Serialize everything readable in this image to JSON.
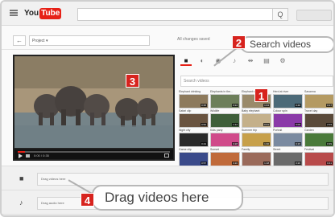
{
  "app": {
    "logo_you": "You",
    "logo_tube": "Tube",
    "search_button": "Q"
  },
  "project_bar": {
    "back": "←",
    "project_name": "Project ▾",
    "status": "All changes saved"
  },
  "player": {
    "time": "0:00 / 0:35",
    "progress": 0.05
  },
  "panel": {
    "tabs": [
      {
        "icon": "■",
        "name": "videos-tab"
      },
      {
        "icon": "◐",
        "name": "creative-commons-tab"
      },
      {
        "icon": "◉",
        "name": "photos-tab"
      },
      {
        "icon": "♪",
        "name": "music-tab"
      },
      {
        "icon": "⇹",
        "name": "transitions-tab"
      },
      {
        "icon": "▤",
        "name": "titles-tab"
      },
      {
        "icon": "⚙",
        "name": "settings-tab"
      }
    ],
    "search_placeholder": "Search videos",
    "thumbnails": [
      {
        "title": "Elephant drinking",
        "duration": "0:35",
        "color": "#8d7a5c"
      },
      {
        "title": "Elephants in the...",
        "duration": "0:22",
        "color": "#6d7f5a"
      },
      {
        "title": "Elephant walk",
        "duration": "1:04",
        "color": "#9a8a6a"
      },
      {
        "title": "Herd at river",
        "duration": "0:48",
        "color": "#4c6a78"
      },
      {
        "title": "Savanna",
        "duration": "0:17",
        "color": "#b49a62"
      },
      {
        "title": "Safari clip",
        "duration": "0:52",
        "color": "#6a5440"
      },
      {
        "title": "Wildlife",
        "duration": "1:12",
        "color": "#3f5f3a"
      },
      {
        "title": "Baby elephant",
        "duration": "0:31",
        "color": "#c4b08a"
      },
      {
        "title": "Colour spin",
        "duration": "0:09",
        "color": "#8a3aa8"
      },
      {
        "title": "Travel day",
        "duration": "2:03",
        "color": "#5a4a3a"
      },
      {
        "title": "Night city",
        "duration": "0:44",
        "color": "#2a2a2a"
      },
      {
        "title": "Kids party",
        "duration": "0:28",
        "color": "#d04a8a"
      },
      {
        "title": "Summer trip",
        "duration": "1:30",
        "color": "#c7a04a"
      },
      {
        "title": "Portrait",
        "duration": "0:15",
        "color": "#7a8aa0"
      },
      {
        "title": "Garden",
        "duration": "0:39",
        "color": "#4a7a3a"
      },
      {
        "title": "Game clip",
        "duration": "0:57",
        "color": "#3a4a8a"
      },
      {
        "title": "Sunset",
        "duration": "0:20",
        "color": "#c06a3a"
      },
      {
        "title": "Family",
        "duration": "1:18",
        "color": "#9a6a5a"
      },
      {
        "title": "Street",
        "duration": "0:26",
        "color": "#6a6a6a"
      },
      {
        "title": "Festival",
        "duration": "0:41",
        "color": "#b84a4a"
      }
    ]
  },
  "timeline": {
    "video_track": {
      "icon": "■",
      "label": "Drag videos here"
    },
    "audio_track": {
      "icon": "♪",
      "label": "Drag audio here"
    }
  },
  "callouts": [
    {
      "number": "1",
      "name": "callout-1-badge"
    },
    {
      "number": "2",
      "label": "Search videos"
    },
    {
      "number": "3",
      "name": "callout-3-badge"
    },
    {
      "number": "4",
      "label": "Drag videos here"
    }
  ]
}
